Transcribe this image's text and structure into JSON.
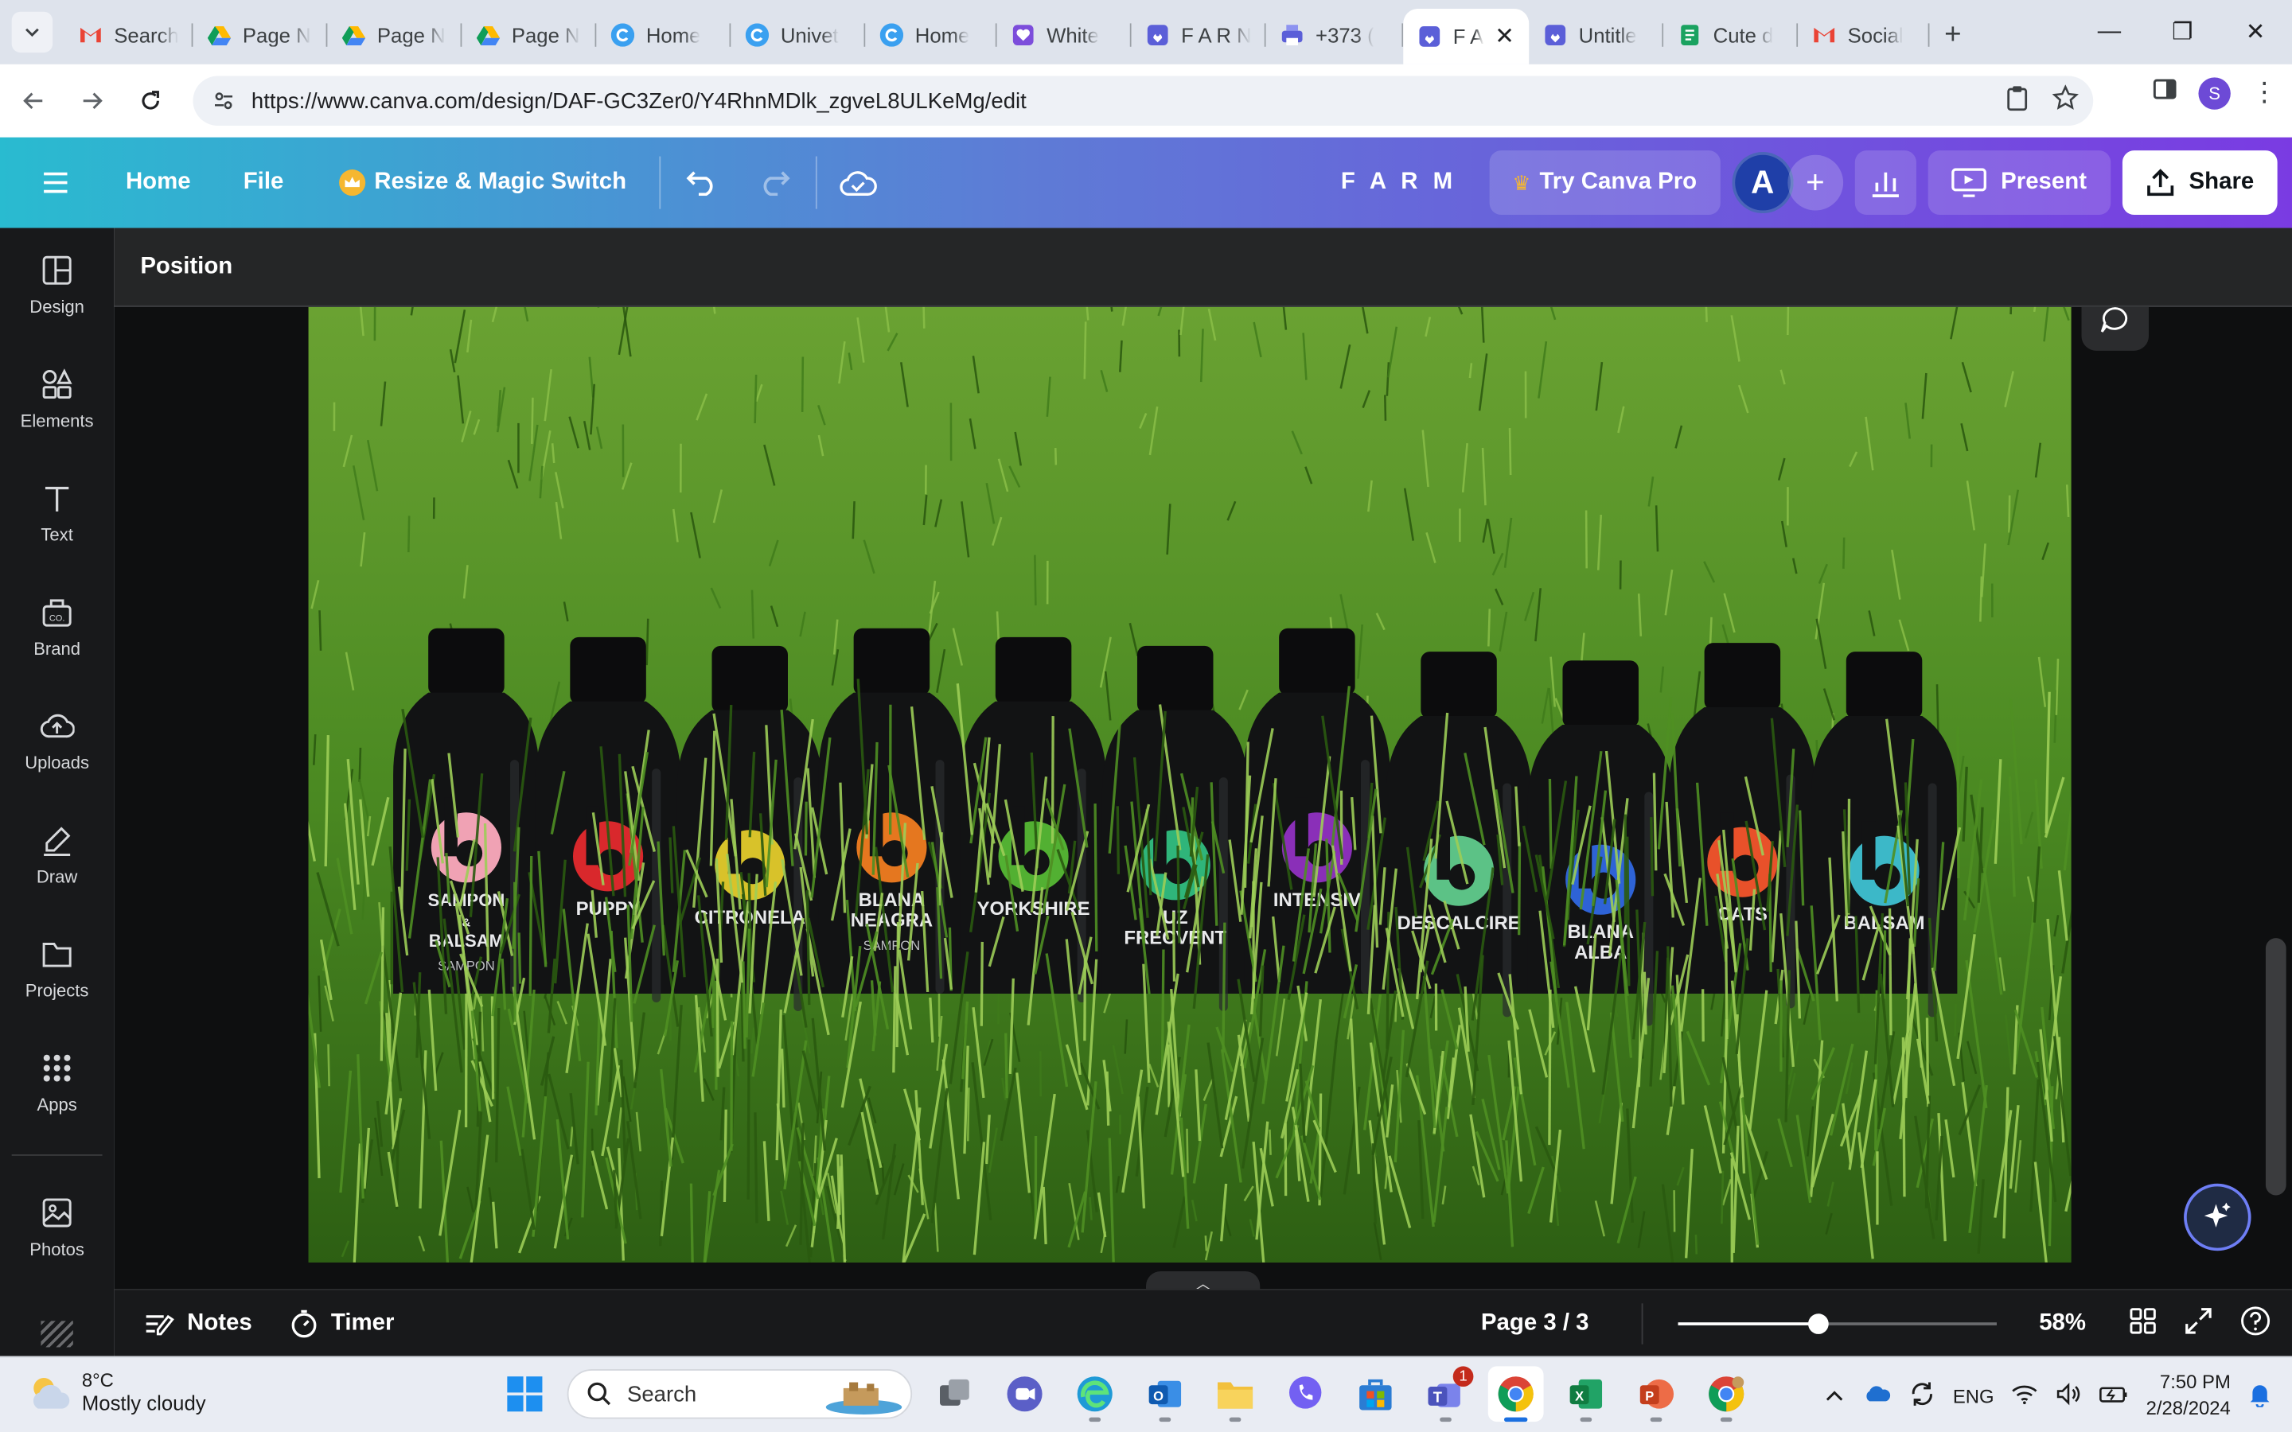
{
  "browser": {
    "tabs": [
      {
        "label": "Search",
        "icon": "gmail-icon",
        "active": false
      },
      {
        "label": "Page N",
        "icon": "drive-icon",
        "active": false
      },
      {
        "label": "Page N",
        "icon": "drive-icon",
        "active": false
      },
      {
        "label": "Page N",
        "icon": "drive-icon",
        "active": false
      },
      {
        "label": "Home",
        "icon": "canva-icon",
        "active": false
      },
      {
        "label": "Univet",
        "icon": "canva-icon",
        "active": false
      },
      {
        "label": "Home",
        "icon": "canva-icon",
        "active": false
      },
      {
        "label": "White",
        "icon": "canva-heart-icon",
        "active": false
      },
      {
        "label": "F A R N",
        "icon": "canva-design-icon",
        "active": false
      },
      {
        "label": "+373 (",
        "icon": "printer-icon",
        "active": false
      },
      {
        "label": "F A",
        "icon": "canva-design-icon",
        "active": true
      },
      {
        "label": "Untitle",
        "icon": "canva-design-icon",
        "active": false
      },
      {
        "label": "Cute d",
        "icon": "doc-icon",
        "active": false
      },
      {
        "label": "Social",
        "icon": "gmail-icon",
        "active": false
      }
    ],
    "url": "https://www.canva.com/design/DAF-GC3Zer0/Y4RhnMDlk_zgveL8ULKeMg/edit",
    "profile_initial": "S"
  },
  "canva": {
    "menu": {
      "home": "Home",
      "file": "File",
      "resize": "Resize & Magic Switch"
    },
    "design_title": "F A R M",
    "try_pro": "Try Canva Pro",
    "avatar_initial": "A",
    "present": "Present",
    "share": "Share",
    "accent_gradient": [
      "#29bbd0",
      "#7a3be2"
    ]
  },
  "sidebar": {
    "items": [
      {
        "label": "Design",
        "icon": "design-icon"
      },
      {
        "label": "Elements",
        "icon": "elements-icon"
      },
      {
        "label": "Text",
        "icon": "text-icon"
      },
      {
        "label": "Brand",
        "icon": "brand-icon"
      },
      {
        "label": "Uploads",
        "icon": "uploads-icon"
      },
      {
        "label": "Draw",
        "icon": "draw-icon"
      },
      {
        "label": "Projects",
        "icon": "projects-icon"
      },
      {
        "label": "Apps",
        "icon": "apps-icon"
      },
      {
        "label": "Photos",
        "icon": "photos-icon"
      }
    ]
  },
  "toolbar": {
    "position_label": "Position"
  },
  "photo": {
    "bottles": [
      {
        "label": "SAMPON & BALSAM",
        "sub": "SAMPON",
        "color": "#f0a2b4"
      },
      {
        "label": "PUPPY",
        "sub": "",
        "color": "#d9282c"
      },
      {
        "label": "CITRONELA",
        "sub": "",
        "color": "#d8c22a"
      },
      {
        "label": "BLANA NEAGRA",
        "sub": "SAMPON",
        "color": "#e5771f"
      },
      {
        "label": "YORKSHIRE",
        "sub": "",
        "color": "#52b032"
      },
      {
        "label": "UZ FRECVENT",
        "sub": "",
        "color": "#2fb57a"
      },
      {
        "label": "INTENSIV",
        "sub": "",
        "color": "#8a2fb8"
      },
      {
        "label": "DESCALCIRE",
        "sub": "",
        "color": "#5cc286"
      },
      {
        "label": "BLANA ALBA",
        "sub": "",
        "color": "#2e63d6"
      },
      {
        "label": "CATS",
        "sub": "",
        "color": "#e8512a"
      },
      {
        "label": "BALSAM",
        "sub": "",
        "color": "#3cb8c8"
      }
    ]
  },
  "bottom": {
    "notes": "Notes",
    "timer": "Timer",
    "page_indicator": "Page 3 / 3",
    "zoom": "58%",
    "zoom_fraction": 0.44
  },
  "taskbar": {
    "temperature": "8°C",
    "weather": "Mostly cloudy",
    "search": "Search",
    "language": "ENG",
    "time": "7:50 PM",
    "date": "2/28/2024",
    "teams_badge": "1"
  }
}
